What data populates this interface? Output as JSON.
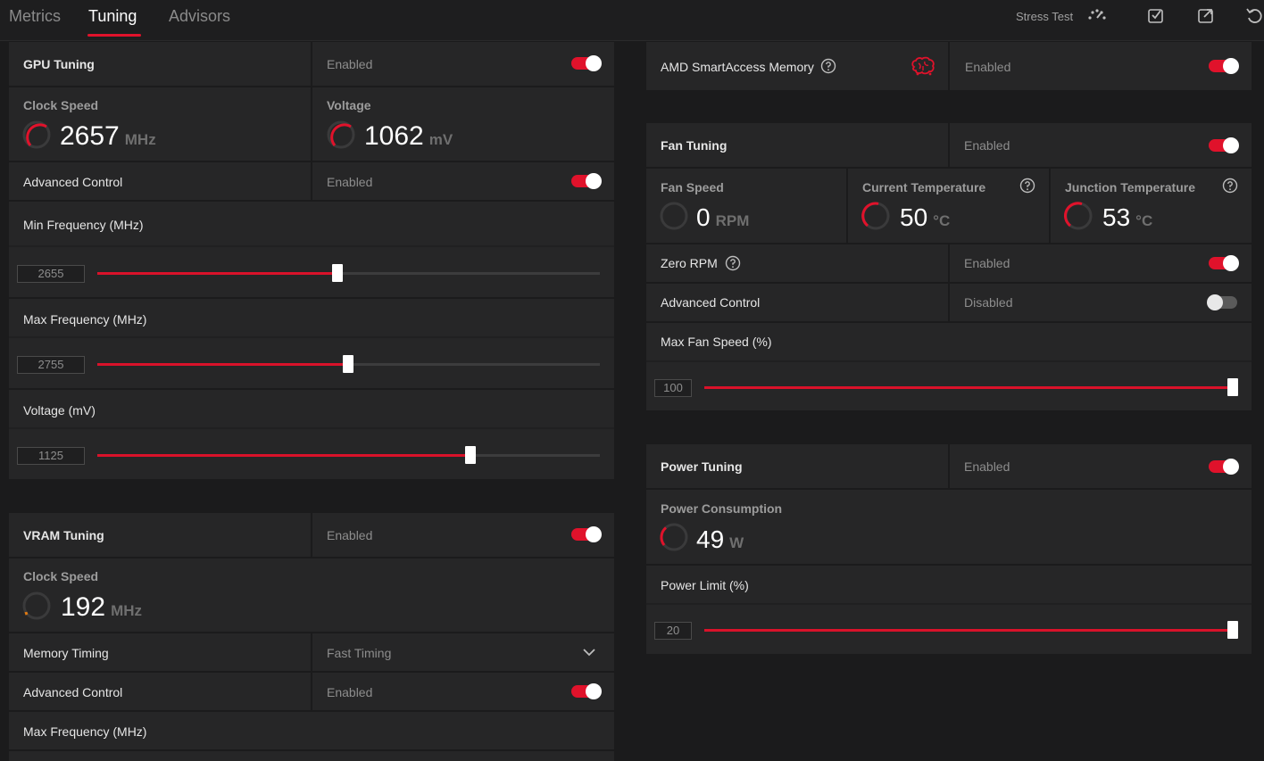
{
  "tabs": [
    {
      "label": "Metrics"
    },
    {
      "label": "Tuning"
    },
    {
      "label": "Advisors"
    }
  ],
  "toolbar": {
    "stress_test_label": "Stress Test",
    "icons": [
      "stress-test-icon",
      "import-icon",
      "export-icon",
      "reset-icon"
    ]
  },
  "gpu_tuning": {
    "title": "GPU Tuning",
    "status": "Enabled",
    "enabled": true,
    "clock_speed": {
      "title": "Clock Speed",
      "value": "2657",
      "unit": "MHz"
    },
    "voltage": {
      "title": "Voltage",
      "value": "1062",
      "unit": "mV"
    },
    "advanced_control": {
      "label": "Advanced Control",
      "status": "Enabled",
      "enabled": true
    },
    "min_frequency": {
      "label": "Min Frequency (MHz)",
      "value": "2655",
      "fraction": 0.48
    },
    "max_frequency": {
      "label": "Max Frequency (MHz)",
      "value": "2755",
      "fraction": 0.5
    },
    "voltage_slider": {
      "label": "Voltage (mV)",
      "value": "1125",
      "fraction": 0.74
    }
  },
  "vram_tuning": {
    "title": "VRAM Tuning",
    "status": "Enabled",
    "enabled": true,
    "clock_speed": {
      "title": "Clock Speed",
      "value": "192",
      "unit": "MHz"
    },
    "memory_timing": {
      "label": "Memory Timing",
      "value": "Fast Timing"
    },
    "advanced_control": {
      "label": "Advanced Control",
      "status": "Enabled",
      "enabled": true
    },
    "max_frequency": {
      "label": "Max Frequency (MHz)"
    }
  },
  "smart_access_memory": {
    "label": "AMD SmartAccess Memory",
    "status": "Enabled",
    "enabled": true
  },
  "fan_tuning": {
    "title": "Fan Tuning",
    "status": "Enabled",
    "enabled": true,
    "fan_speed": {
      "title": "Fan Speed",
      "value": "0",
      "unit": "RPM"
    },
    "current_temperature": {
      "title": "Current Temperature",
      "value": "50",
      "unit": "°C"
    },
    "junction_temperature": {
      "title": "Junction Temperature",
      "value": "53",
      "unit": "°C"
    },
    "zero_rpm": {
      "label": "Zero RPM",
      "status": "Enabled",
      "enabled": true
    },
    "advanced_control": {
      "label": "Advanced Control",
      "status": "Disabled",
      "enabled": false
    },
    "max_fan_speed": {
      "label": "Max Fan Speed (%)",
      "value": "100",
      "fraction": 1.0
    }
  },
  "power_tuning": {
    "title": "Power Tuning",
    "status": "Enabled",
    "enabled": true,
    "power_consumption": {
      "title": "Power Consumption",
      "value": "49",
      "unit": "W"
    },
    "power_limit": {
      "label": "Power Limit (%)",
      "value": "20",
      "fraction": 1.0
    }
  },
  "colors": {
    "accent": "#e0122b",
    "panel": "#262627",
    "background": "#1b1b1c"
  }
}
